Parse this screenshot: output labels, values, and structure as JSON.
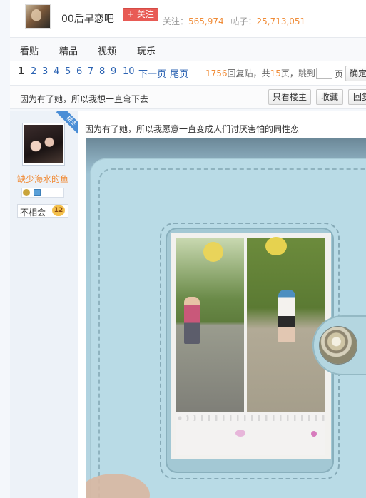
{
  "header": {
    "forum_name": "00后早恋吧",
    "follow_label": "+ 关注",
    "stats": {
      "follow_label": "关注：",
      "follow_count": "565,974",
      "posts_label": "帖子：",
      "post_count": "25,713,051"
    }
  },
  "tabs": [
    "看贴",
    "精品",
    "视频",
    "玩乐"
  ],
  "pager": {
    "pages": [
      "1",
      "2",
      "3",
      "4",
      "5",
      "6",
      "7",
      "8",
      "9",
      "10"
    ],
    "current_page": "1",
    "next_label": "下一页",
    "last_label": "尾页",
    "reply_count": "1756",
    "reply_label": "回复贴，共",
    "total_pages": "15",
    "pages_label": "页，跳到",
    "page_unit": "页",
    "go_label": "确定"
  },
  "thread": {
    "title": "因为有了她，所以我想一直弯下去",
    "only_author_label": "只看楼主",
    "favorite_label": "收藏",
    "reply_label": "回复"
  },
  "post": {
    "author_badge": "楼主",
    "username": "缺少海水的鱼",
    "relation_label": "不相会",
    "level": "12",
    "text": "因为有了她，所以我愿意一直变成人们讨厌害怕的同性恋"
  },
  "colors": {
    "accent_orange": "#f08c38",
    "link_blue": "#2d64b3",
    "follow_red": "#e85b55",
    "badge_blue": "#4b8ed6"
  }
}
